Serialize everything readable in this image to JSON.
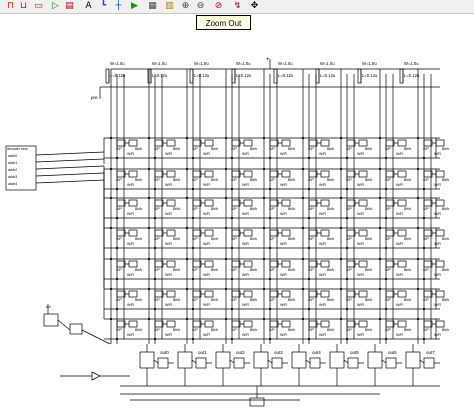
{
  "toolbar": {
    "buttons": [
      {
        "name": "nmos-icon",
        "glyph": "⊓",
        "color": "#d00000"
      },
      {
        "name": "pmos-icon",
        "glyph": "⊔",
        "color": "#d00000"
      },
      {
        "name": "gate-icon",
        "glyph": "▭",
        "color": "#d00000"
      },
      {
        "name": "inverter-icon",
        "glyph": "▷",
        "color": "#008000"
      },
      {
        "name": "library-icon",
        "glyph": "▤",
        "color": "#b00000"
      },
      {
        "name": "text-icon",
        "glyph": "A",
        "color": "#000000"
      },
      {
        "name": "wire-icon",
        "glyph": "┗",
        "color": "#0050d0"
      },
      {
        "name": "node-icon",
        "glyph": "┼",
        "color": "#0050d0"
      },
      {
        "name": "run-icon",
        "glyph": "▶",
        "color": "#00a000"
      },
      {
        "name": "chip-icon",
        "glyph": "▦",
        "color": "#404040"
      },
      {
        "name": "book-icon",
        "glyph": "▥",
        "color": "#b08000"
      },
      {
        "name": "zoom-in-icon",
        "glyph": "⊕",
        "color": "#404040"
      },
      {
        "name": "zoom-out-icon",
        "glyph": "⊖",
        "color": "#404040"
      },
      {
        "name": "measure-icon",
        "glyph": "⊘",
        "color": "#c00000"
      },
      {
        "name": "timing-icon",
        "glyph": "↯",
        "color": "#c00000"
      },
      {
        "name": "move-icon",
        "glyph": "✥",
        "color": "#000000"
      }
    ],
    "tooltip": "Zoom Out"
  },
  "schematic": {
    "supply_label": "pre",
    "pmos_labels": [
      {
        "w": "W=1.0u",
        "l": "L=0.12u"
      },
      {
        "w": "W=1.0u",
        "l": "L=0.12u"
      },
      {
        "w": "W=1.0u",
        "l": "L=0.12u"
      },
      {
        "w": "W=1.0u",
        "l": "L=0.12u"
      },
      {
        "w": "W=1.0u",
        "l": "L=0.12u"
      },
      {
        "w": "W=1.0u",
        "l": "L=0.12u"
      },
      {
        "w": "W=1.0u",
        "l": "L=0.12u"
      },
      {
        "w": "W=1.0u",
        "l": "L=0.12u"
      }
    ],
    "decoder": {
      "title": "decoder new",
      "pins": [
        "addr0",
        "addr1",
        "addr2",
        "addr3",
        "addr4"
      ]
    },
    "cell_labels": {
      "data": "S/P",
      "wl": "W/R",
      "bl": "Bit/b"
    },
    "bottom_labels": {
      "wr": "w/r",
      "outs": [
        "out0",
        "out1",
        "out2",
        "out3",
        "out4",
        "out5",
        "out6",
        "out7"
      ]
    }
  }
}
